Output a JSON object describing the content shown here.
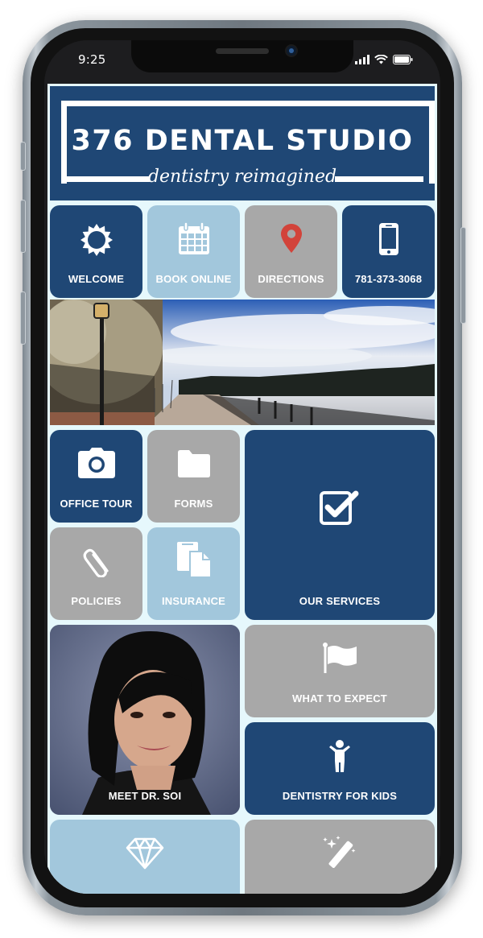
{
  "status_bar": {
    "time": "9:25",
    "icons": [
      "signal-icon",
      "wifi-icon",
      "battery-icon"
    ]
  },
  "header": {
    "title": "376 DENTAL STUDIO",
    "tagline": "dentistry reimagined"
  },
  "colors": {
    "navy": "#1f4775",
    "light_blue": "#a2c7dc",
    "gray": "#a8a8a8",
    "background": "#e6f8fc",
    "pin_red": "#d2433a"
  },
  "tiles": {
    "welcome": {
      "label": "WELCOME",
      "icon": "sun-icon"
    },
    "book_online": {
      "label": "BOOK ONLINE",
      "icon": "calendar-icon"
    },
    "directions": {
      "label": "DIRECTIONS",
      "icon": "map-pin-icon"
    },
    "phone": {
      "label": "781-373-3068",
      "icon": "mobile-phone-icon"
    },
    "office_tour": {
      "label": "OFFICE TOUR",
      "icon": "camera-icon"
    },
    "forms": {
      "label": "FORMS",
      "icon": "folder-icon"
    },
    "our_services": {
      "label": "OUR SERVICES",
      "icon": "checkbox-icon"
    },
    "policies": {
      "label": "POLICIES",
      "icon": "paperclip-icon"
    },
    "insurance": {
      "label": "INSURANCE",
      "icon": "documents-icon"
    },
    "meet_doctor": {
      "label": "MEET DR. SOI"
    },
    "what_to_expect": {
      "label": "WHAT TO EXPECT",
      "icon": "flag-icon"
    },
    "dentistry_for_kids": {
      "label": "DENTISTRY FOR KIDS",
      "icon": "child-icon"
    },
    "bottom_left": {
      "icon": "diamond-icon"
    },
    "bottom_right": {
      "icon": "magic-wand-icon"
    }
  },
  "banner": {
    "alt": "Waterfront walkway with lamp post and lake"
  }
}
